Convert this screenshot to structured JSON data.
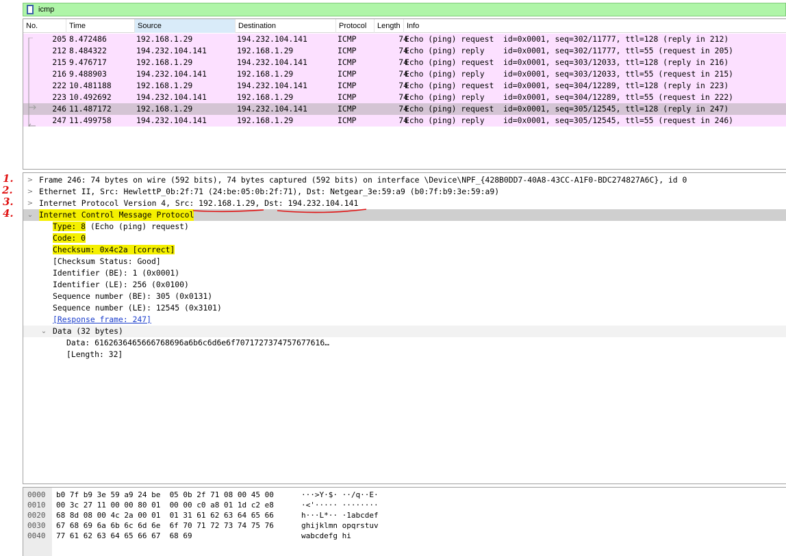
{
  "filter": {
    "value": "icmp"
  },
  "columns": [
    "No.",
    "Time",
    "Source",
    "Destination",
    "Protocol",
    "Length",
    "Info"
  ],
  "packets": [
    {
      "no": "205",
      "time": "8.472486",
      "src": "192.168.1.29",
      "dst": "194.232.104.141",
      "proto": "ICMP",
      "len": "74",
      "info": "Echo (ping) request  id=0x0001, seq=302/11777, ttl=128 (reply in 212)"
    },
    {
      "no": "212",
      "time": "8.484322",
      "src": "194.232.104.141",
      "dst": "192.168.1.29",
      "proto": "ICMP",
      "len": "74",
      "info": "Echo (ping) reply    id=0x0001, seq=302/11777, ttl=55 (request in 205)"
    },
    {
      "no": "215",
      "time": "9.476717",
      "src": "192.168.1.29",
      "dst": "194.232.104.141",
      "proto": "ICMP",
      "len": "74",
      "info": "Echo (ping) request  id=0x0001, seq=303/12033, ttl=128 (reply in 216)"
    },
    {
      "no": "216",
      "time": "9.488903",
      "src": "194.232.104.141",
      "dst": "192.168.1.29",
      "proto": "ICMP",
      "len": "74",
      "info": "Echo (ping) reply    id=0x0001, seq=303/12033, ttl=55 (request in 215)"
    },
    {
      "no": "222",
      "time": "10.481188",
      "src": "192.168.1.29",
      "dst": "194.232.104.141",
      "proto": "ICMP",
      "len": "74",
      "info": "Echo (ping) request  id=0x0001, seq=304/12289, ttl=128 (reply in 223)"
    },
    {
      "no": "223",
      "time": "10.492692",
      "src": "194.232.104.141",
      "dst": "192.168.1.29",
      "proto": "ICMP",
      "len": "74",
      "info": "Echo (ping) reply    id=0x0001, seq=304/12289, ttl=55 (request in 222)"
    },
    {
      "no": "246",
      "time": "11.487172",
      "src": "192.168.1.29",
      "dst": "194.232.104.141",
      "proto": "ICMP",
      "len": "74",
      "info": "Echo (ping) request  id=0x0001, seq=305/12545, ttl=128 (reply in 247)"
    },
    {
      "no": "247",
      "time": "11.499758",
      "src": "194.232.104.141",
      "dst": "192.168.1.29",
      "proto": "ICMP",
      "len": "74",
      "info": "Echo (ping) reply    id=0x0001, seq=305/12545, ttl=55 (request in 246)"
    }
  ],
  "details": {
    "frame": "Frame 246: 74 bytes on wire (592 bits), 74 bytes captured (592 bits) on interface \\Device\\NPF_{428B0DD7-40A8-43CC-A1F0-BDC274827A6C}, id 0",
    "ethernet": "Ethernet II, Src: HewlettP_0b:2f:71 (24:be:05:0b:2f:71), Dst: Netgear_3e:59:a9 (b0:7f:b9:3e:59:a9)",
    "ip": "Internet Protocol Version 4, Src: 192.168.1.29, Dst: 194.232.104.141",
    "icmp": "Internet Control Message Protocol",
    "type": "Type: 8",
    "type_rest": " (Echo (ping) request)",
    "code": "Code: 0",
    "checksum": "Checksum: 0x4c2a [correct]",
    "checksum_status": "[Checksum Status: Good]",
    "id_be": "Identifier (BE): 1 (0x0001)",
    "id_le": "Identifier (LE): 256 (0x0100)",
    "seq_be": "Sequence number (BE): 305 (0x0131)",
    "seq_le": "Sequence number (LE): 12545 (0x3101)",
    "response_frame": "[Response frame: 247]",
    "data_header": "Data (32 bytes)",
    "data_value": "Data: 6162636465666768696a6b6c6d6e6f7071727374757677616…",
    "data_length": "[Length: 32]"
  },
  "hex": [
    {
      "off": "0000",
      "bytes": "b0 7f b9 3e 59 a9 24 be  05 0b 2f 71 08 00 45 00",
      "ascii": "···>Y·$· ··/q··E·"
    },
    {
      "off": "0010",
      "bytes": "00 3c 27 11 00 00 80 01  00 00 c0 a8 01 1d c2 e8",
      "ascii": "·<'····· ········"
    },
    {
      "off": "0020",
      "bytes": "68 8d 08 00 4c 2a 00 01  01 31 61 62 63 64 65 66",
      "ascii": "h···L*·· ·1abcdef"
    },
    {
      "off": "0030",
      "bytes": "67 68 69 6a 6b 6c 6d 6e  6f 70 71 72 73 74 75 76",
      "ascii": "ghijklmn opqrstuv"
    },
    {
      "off": "0040",
      "bytes": "77 61 62 63 64 65 66 67  68 69",
      "ascii": "wabcdefg hi"
    }
  ],
  "annotations": [
    "1.",
    "2.",
    "3.",
    "4."
  ],
  "colors": {
    "row_bg": "#fce0ff",
    "selected_row_bg": "#d4c4d4",
    "filter_bg": "#aff5a8",
    "highlight": "#f5f000",
    "annotation": "#e01010"
  }
}
